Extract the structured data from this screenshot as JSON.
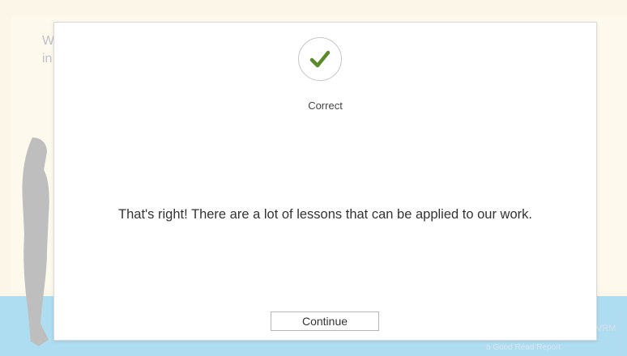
{
  "background": {
    "slide_text": "W in",
    "footer_text": "VRM",
    "footer_subtext": "a Good Read Report"
  },
  "dialog": {
    "icon": "checkmark-icon",
    "status": "Correct",
    "message": "That's right!  There are a lot of lessons that can be applied to our work.",
    "continue_label": "Continue"
  },
  "colors": {
    "check": "#5a8a2a",
    "floor": "#a8d9ef",
    "background": "#fbf6e6"
  }
}
